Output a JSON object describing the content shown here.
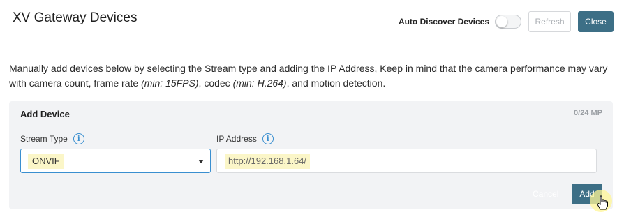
{
  "header": {
    "title": "XV Gateway Devices",
    "auto_discover_label": "Auto Discover Devices",
    "auto_discover_enabled": false,
    "refresh_label": "Refresh",
    "close_label": "Close"
  },
  "description": {
    "part1": "Manually add devices below by selecting the Stream type and adding the IP Address, Keep in mind that the camera performance may vary with camera count, frame rate ",
    "framerate_note": "(min: 15FPS)",
    "part2": ", codec ",
    "codec_note": "(min: H.264)",
    "part3": ", and motion detection."
  },
  "add_device": {
    "title": "Add Device",
    "mp_count": "0/24 MP",
    "stream_type_label": "Stream Type",
    "stream_type_value": "ONVIF",
    "ip_label": "IP Address",
    "ip_value": "http://192.168.1.64/",
    "cancel_label": "Cancel",
    "add_label": "Add"
  },
  "icons": {
    "info": "info-icon",
    "caret": "chevron-down-icon",
    "cursor": "pointer-cursor-icon"
  },
  "colors": {
    "primary": "#3d6f86",
    "info": "#3a8fd0",
    "highlight": "#fbf6c8",
    "panel": "#f2f3f5"
  }
}
